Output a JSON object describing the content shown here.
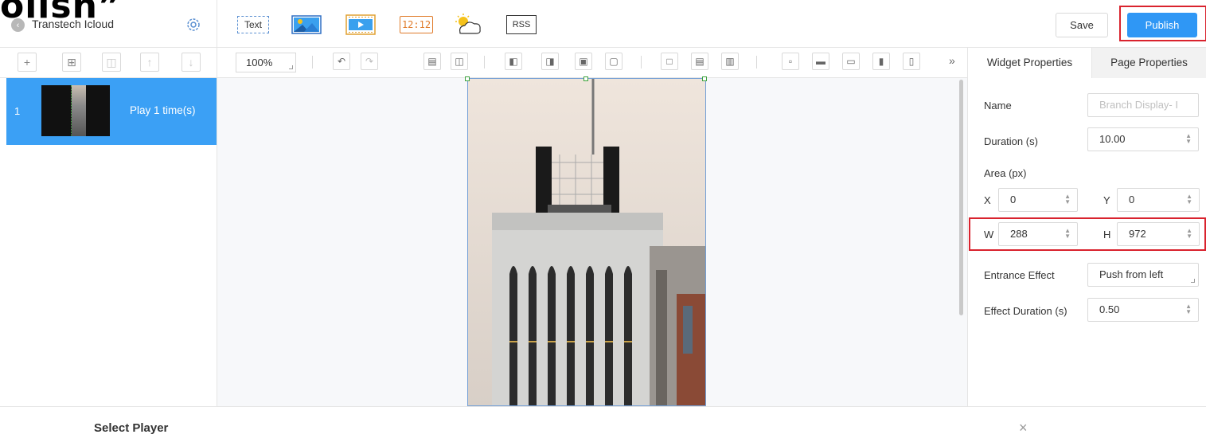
{
  "overlay": {
    "text": "olish”"
  },
  "app": {
    "title": "Transtech Icloud"
  },
  "toolbar": {
    "text_widget": "Text",
    "clock_widget": "12:12",
    "rss_widget": "RSS",
    "save_label": "Save",
    "publish_label": "Publish",
    "zoom": "100%"
  },
  "tabs": {
    "widget": "Widget Properties",
    "page": "Page Properties"
  },
  "pages": [
    {
      "number": "1",
      "label": "Play 1 time(s)"
    }
  ],
  "properties": {
    "name_label": "Name",
    "name_placeholder": "Branch Display- I",
    "duration_label": "Duration (s)",
    "duration_value": "10.00",
    "area_label": "Area (px)",
    "x_label": "X",
    "x_value": "0",
    "y_label": "Y",
    "y_value": "0",
    "w_label": "W",
    "w_value": "288",
    "h_label": "H",
    "h_value": "972",
    "entrance_label": "Entrance Effect",
    "entrance_value": "Push from left",
    "effect_duration_label": "Effect Duration (s)",
    "effect_duration_value": "0.50"
  },
  "dialog": {
    "title": "Select Player",
    "close": "×"
  },
  "colors": {
    "accent": "#2f97f5",
    "highlight": "#d9232e",
    "selected": "#3ba0f5"
  }
}
